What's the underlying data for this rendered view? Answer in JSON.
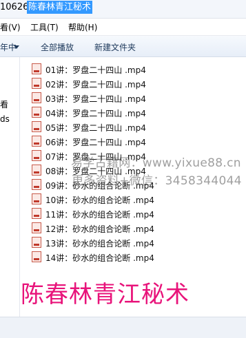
{
  "address": {
    "prefix": "10626\\",
    "selected": "陈春林青江秘术"
  },
  "menu": [
    {
      "label": "看(V)"
    },
    {
      "label": "工具(T)"
    },
    {
      "label": "帮助(H)"
    }
  ],
  "toolbar": {
    "organize_label": "年中",
    "play_all_label": "全部播放",
    "new_folder_label": "新建文件夹"
  },
  "nav": {
    "items": [
      {
        "label": "看"
      },
      {
        "label": "ds"
      }
    ]
  },
  "files": [
    {
      "name": "01讲：罗盘二十四山 .mp4"
    },
    {
      "name": "02讲：罗盘二十四山 .mp4"
    },
    {
      "name": "03讲：罗盘二十四山 .mp4"
    },
    {
      "name": "04讲：罗盘二十四山 .mp4"
    },
    {
      "name": "05讲：罗盘二十四山 .mp4"
    },
    {
      "name": "06讲：罗盘二十四山 .mp4"
    },
    {
      "name": "07讲：罗盘二十四山 .mp4"
    },
    {
      "name": "08讲：罗盘二十四山 .mp4"
    },
    {
      "name": "09讲：砂水的组合论断 .mp4"
    },
    {
      "name": "10讲：砂水的组合论断 .mp4"
    },
    {
      "name": "11讲：砂水的组合论断 .mp4"
    },
    {
      "name": "12讲：砂水的组合论断 .mp4"
    },
    {
      "name": "13讲：砂水的组合论断 .mp4"
    },
    {
      "name": "14讲：砂水的组合论断 .mp4"
    }
  ],
  "watermark": {
    "line1": "易学古籍网：www.yixue88.cn",
    "line2": "更多资料+微信：3458344044"
  },
  "overlay_title": "陈春林青江秘术",
  "colors": {
    "selection": "#3399ff",
    "overlay_title": "#e8137a",
    "file_icon": "#c0392b"
  }
}
